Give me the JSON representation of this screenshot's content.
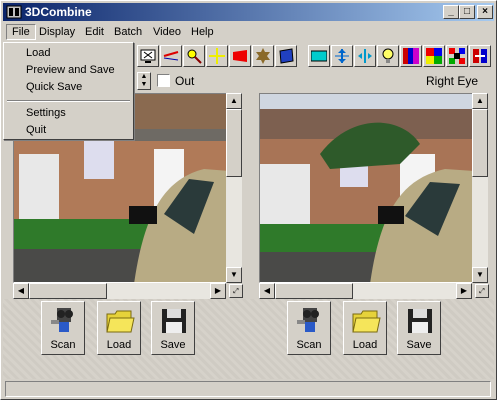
{
  "window": {
    "title": "3DCombine"
  },
  "title_buttons": {
    "minimize": "_",
    "maximize": "□",
    "close": "×"
  },
  "menubar": [
    {
      "label": "File"
    },
    {
      "label": "Display"
    },
    {
      "label": "Edit"
    },
    {
      "label": "Batch"
    },
    {
      "label": "Video"
    },
    {
      "label": "Help"
    }
  ],
  "file_menu": {
    "items": [
      {
        "label": "Load"
      },
      {
        "label": "Preview and Save"
      },
      {
        "label": "Quick Save"
      },
      {
        "label": "Settings"
      },
      {
        "label": "Quit"
      }
    ]
  },
  "toolbar": {
    "tools": [
      "monitor-icon",
      "red-line-icon",
      "magnifier-icon",
      "yellow-cross-icon",
      "red-shape-icon",
      "brown-gear-icon",
      "blue-diamond-icon",
      "cyan-band-icon",
      "vertical-arrows-icon",
      "split-arrows-icon",
      "lightbulb-icon",
      "color-bars-icon",
      "color-squares-icon",
      "rgb-grid-icon",
      "swap-icon"
    ]
  },
  "options": {
    "out_label": "Out",
    "out_checked": false,
    "right_eye_label": "Right Eye"
  },
  "left_panel": {
    "buttons": {
      "scan": "Scan",
      "load": "Load",
      "save": "Save"
    }
  },
  "right_panel": {
    "buttons": {
      "scan": "Scan",
      "load": "Load",
      "save": "Save"
    }
  },
  "status_text": ""
}
